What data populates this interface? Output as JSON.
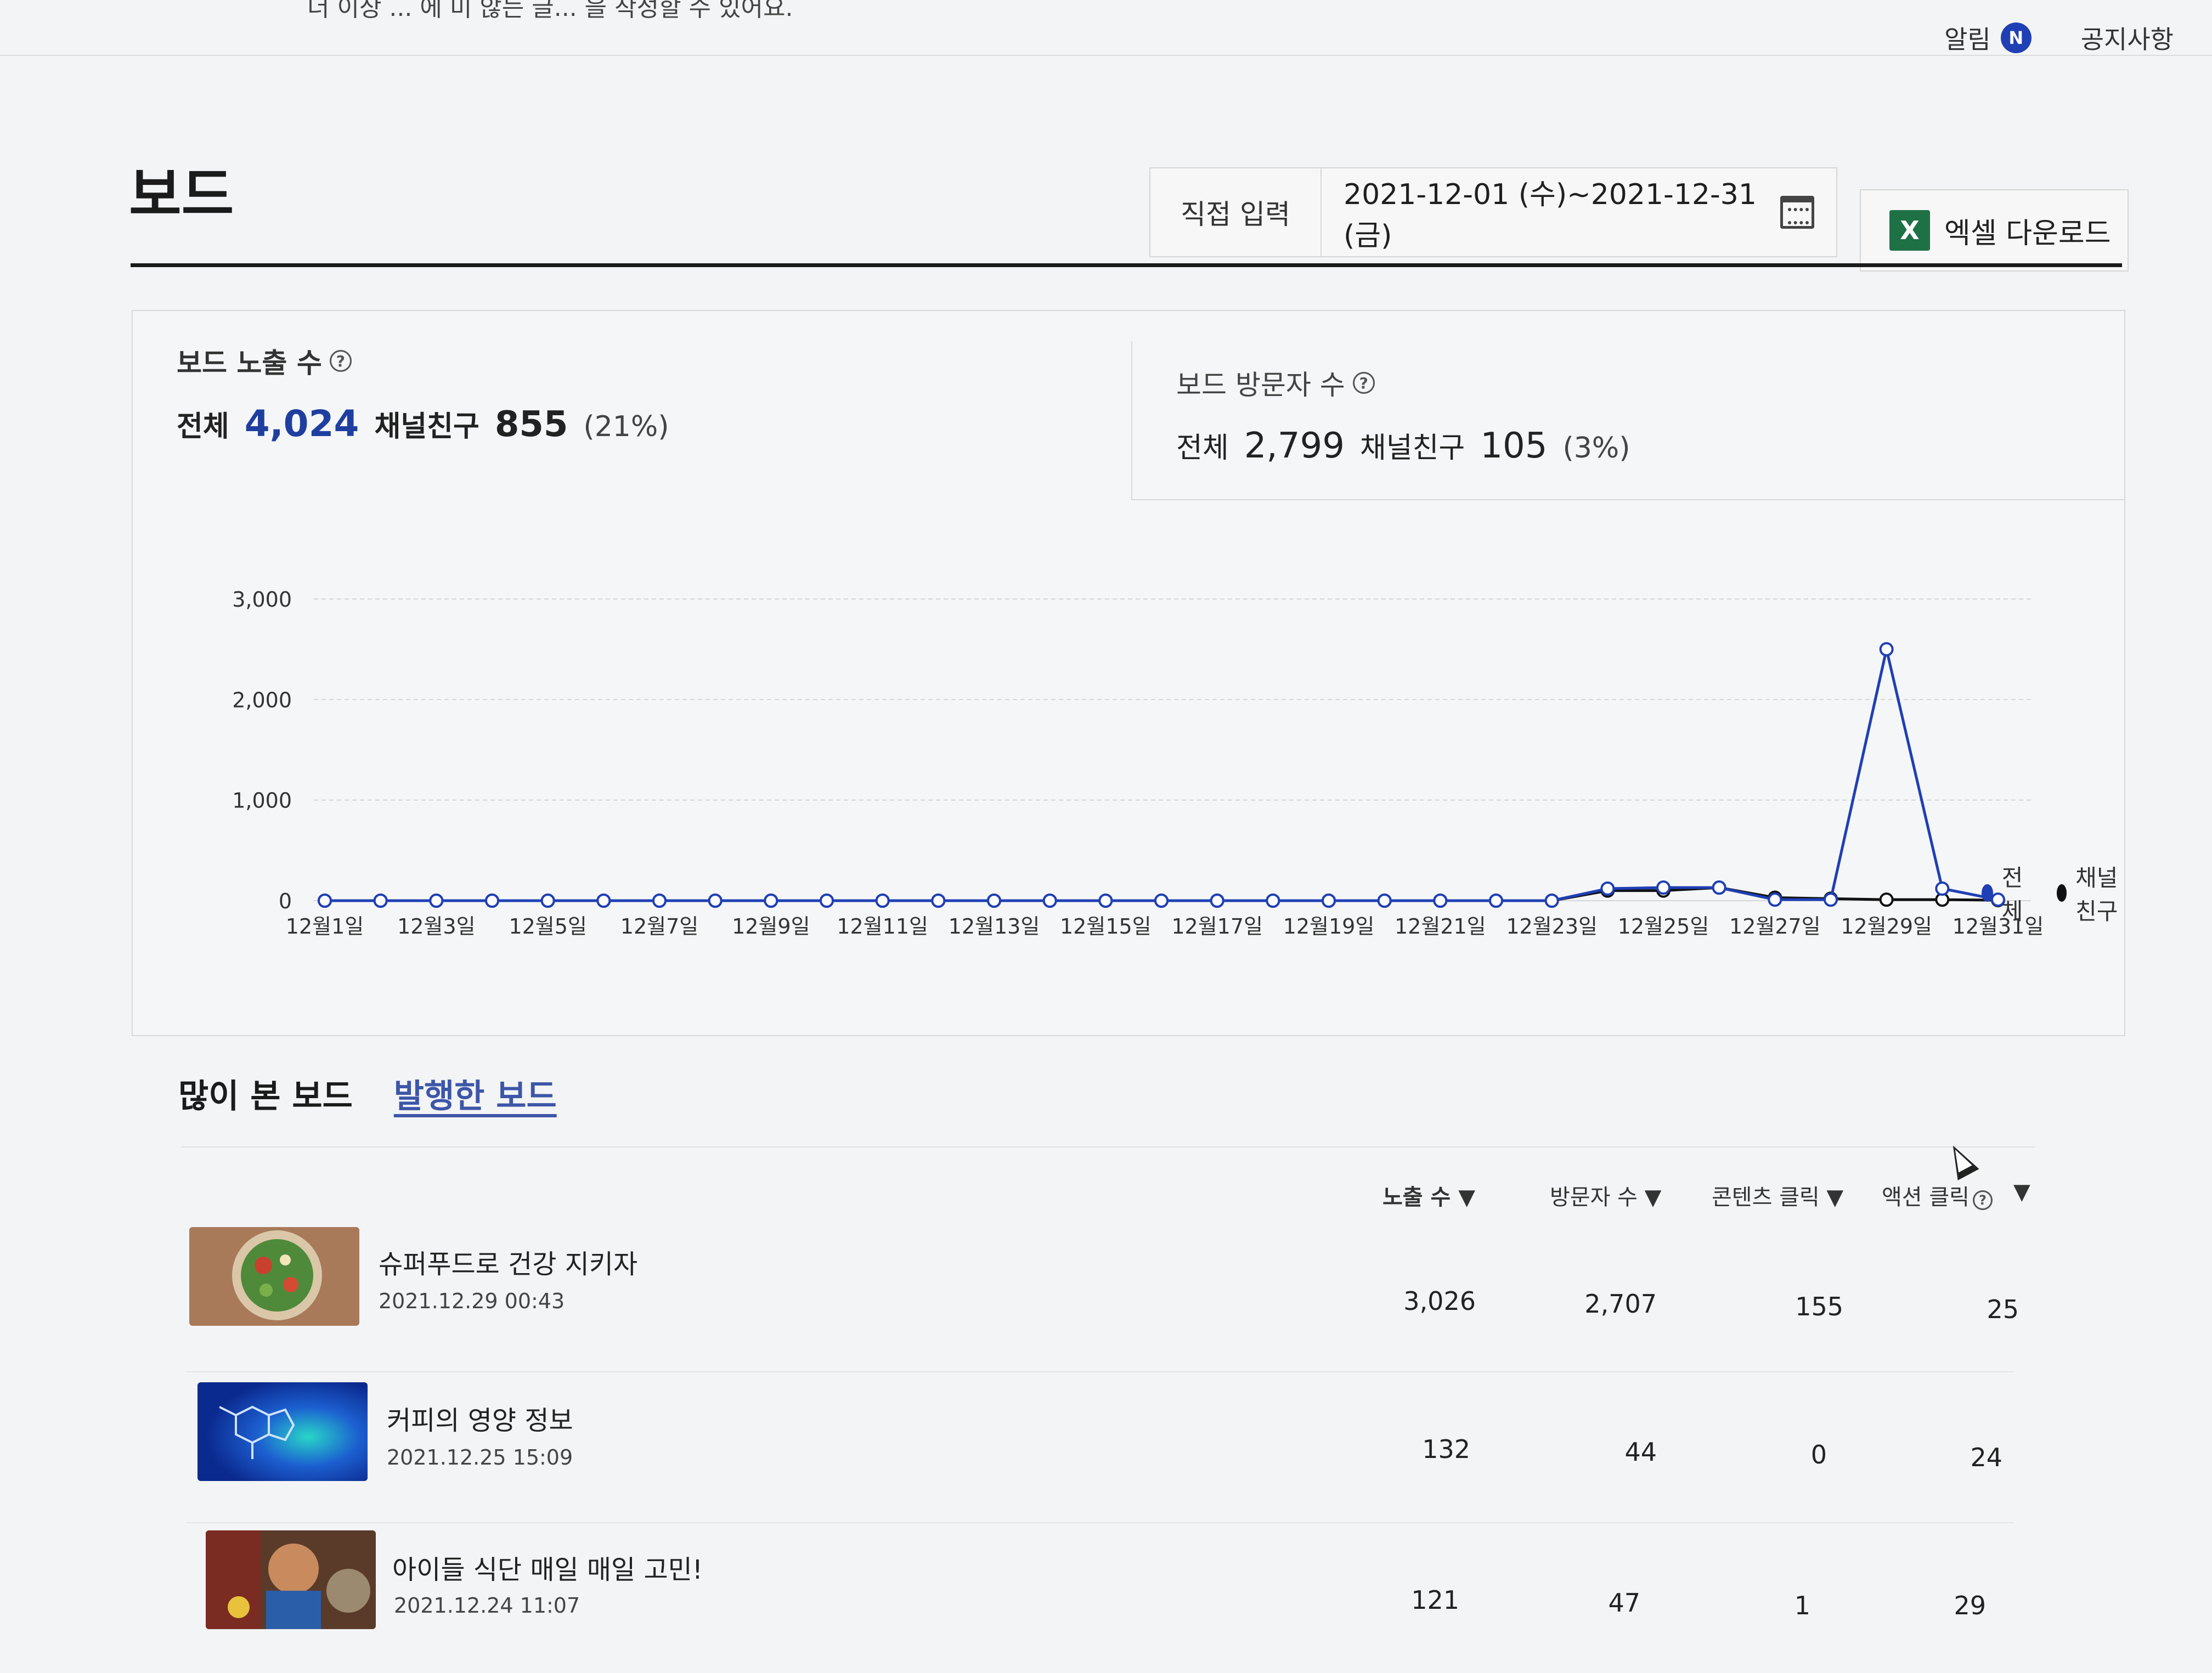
{
  "topbar": {
    "notice": "더 이상 ... 에 미 않는 글... 을 작성할 수 있어요.",
    "alerts_label": "알림",
    "alerts_badge": "N",
    "notice_link": "공지사항"
  },
  "page": {
    "title": "보드"
  },
  "date_filter": {
    "direct_label": "직접 입력",
    "range_text": "2021-12-01 (수)~2021-12-31 (금)",
    "calendar_icon": "calendar-icon"
  },
  "excel": {
    "label": "엑셀 다운로드",
    "icon": "excel-icon"
  },
  "stats": {
    "exposure": {
      "label": "보드 노출 수",
      "total_label": "전체",
      "total": "4,024",
      "friend_label": "채널친구",
      "friend": "855",
      "pct": "(21%)"
    },
    "visitors": {
      "label": "보드 방문자 수",
      "total_label": "전체",
      "total": "2,799",
      "friend_label": "채널친구",
      "friend": "105",
      "pct": "(3%)"
    }
  },
  "chart_data": {
    "type": "line",
    "x": [
      "12월1일",
      "12월2일",
      "12월3일",
      "12월4일",
      "12월5일",
      "12월6일",
      "12월7일",
      "12월8일",
      "12월9일",
      "12월10일",
      "12월11일",
      "12월12일",
      "12월13일",
      "12월14일",
      "12월15일",
      "12월16일",
      "12월17일",
      "12월18일",
      "12월19일",
      "12월20일",
      "12월21일",
      "12월22일",
      "12월23일",
      "12월24일",
      "12월25일",
      "12월26일",
      "12월27일",
      "12월28일",
      "12월29일",
      "12월30일",
      "12월31일"
    ],
    "tick_labels": [
      "12월1일",
      "12월3일",
      "12월5일",
      "12월7일",
      "12월9일",
      "12월11일",
      "12월13일",
      "12월15일",
      "12월17일",
      "12월19일",
      "12월21일",
      "12월23일",
      "12월25일",
      "12월27일",
      "12월29일",
      "12월31일"
    ],
    "y_ticks": [
      "3,000",
      "2,000",
      "1,000",
      "0"
    ],
    "ylim": [
      0,
      3000
    ],
    "grid": true,
    "legend_position": "top-right",
    "series": [
      {
        "name": "전체",
        "color": "#1f3fb5",
        "values": [
          0,
          0,
          0,
          0,
          0,
          0,
          0,
          0,
          0,
          0,
          0,
          0,
          0,
          0,
          0,
          0,
          0,
          0,
          0,
          0,
          0,
          0,
          0,
          120,
          130,
          130,
          10,
          10,
          2500,
          120,
          10
        ]
      },
      {
        "name": "채널친구",
        "color": "#111111",
        "values": [
          0,
          0,
          0,
          0,
          0,
          0,
          0,
          0,
          0,
          0,
          0,
          0,
          0,
          0,
          0,
          0,
          0,
          0,
          0,
          0,
          0,
          0,
          0,
          100,
          100,
          130,
          30,
          20,
          10,
          10,
          5
        ]
      }
    ]
  },
  "tabs": {
    "popular": "많이 본 보드",
    "published": "발행한 보드"
  },
  "columns": {
    "exposure": "노출 수 ▼",
    "visitors": "방문자 수 ▼",
    "content_clicks": "콘텐츠 클릭 ▼",
    "action_clicks": "액션 클릭",
    "action_sort": "▼"
  },
  "rows": [
    {
      "title": "슈퍼푸드로 건강 지키자",
      "date": "2021.12.29 00:43",
      "exposure": "3,026",
      "visitors": "2,707",
      "content_clicks": "155",
      "action_clicks": "25"
    },
    {
      "title": "커피의 영양 정보",
      "date": "2021.12.25 15:09",
      "exposure": "132",
      "visitors": "44",
      "content_clicks": "0",
      "action_clicks": "24"
    },
    {
      "title": "아이들 식단 매일 매일 고민!",
      "date": "2021.12.24 11:07",
      "exposure": "121",
      "visitors": "47",
      "content_clicks": "1",
      "action_clicks": "29"
    }
  ]
}
